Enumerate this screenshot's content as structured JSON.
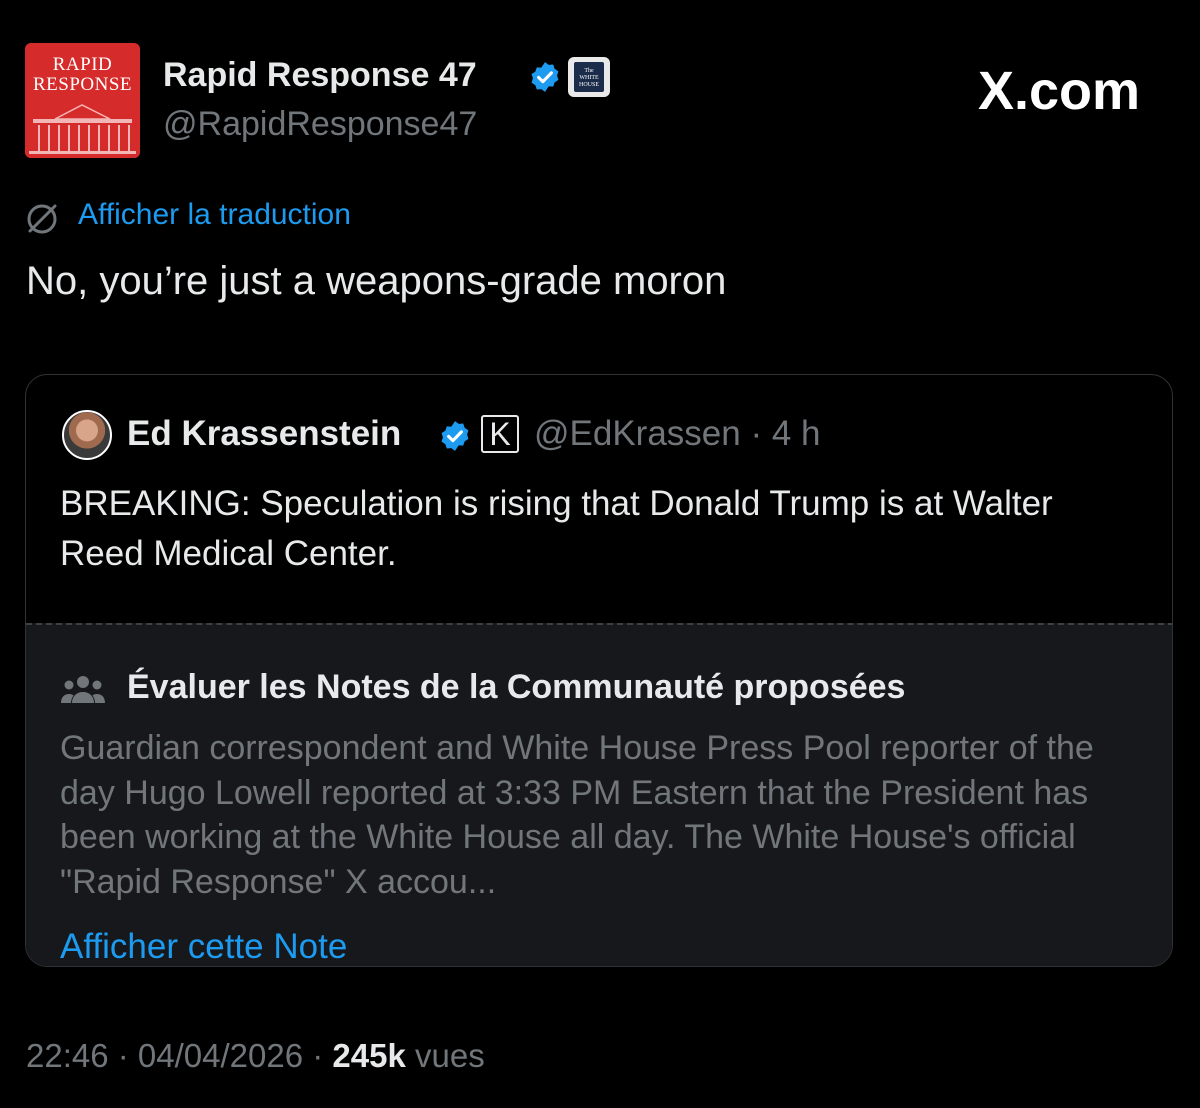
{
  "header": {
    "avatar_logo_line1": "RAPID",
    "avatar_logo_line2": "RESPONSE",
    "author_name": "Rapid Response 47",
    "author_handle": "@RapidResponse47",
    "org_badge_text": "The WHITE HOUSE",
    "site_label": "X.com"
  },
  "tweet": {
    "translate_label": "Afficher la traduction",
    "text": "No, you’re just a weapons-grade moron"
  },
  "quote": {
    "name": "Ed Krassenstein",
    "badge_letter": "K",
    "handle_time": "@EdKrassen · 4 h",
    "text": "BREAKING: Speculation is rising that Donald Trump is at Walter Reed Medical Center."
  },
  "community_note": {
    "title": "Évaluer les Notes de la Communauté proposées",
    "body": "Guardian correspondent and White House Press Pool reporter of the day Hugo Lowell reported at 3:33 PM Eastern that the President has been working at the White House all day.  The White House's official \"Rapid Response\" X accou...",
    "link": "Afficher cette Note"
  },
  "footer": {
    "time_date": "22:46 · 04/04/2026 · ",
    "views_count": "245k",
    "views_label": " vues"
  },
  "colors": {
    "background": "#000000",
    "link_blue": "#1d9bf0",
    "muted_text": "#71767b",
    "verified_blue": "#1d9bf0",
    "avatar_red": "#d62b2b"
  },
  "icons": {
    "verified": "verified-badge-icon",
    "translate": "translate-globe-icon",
    "community": "people-icon"
  }
}
